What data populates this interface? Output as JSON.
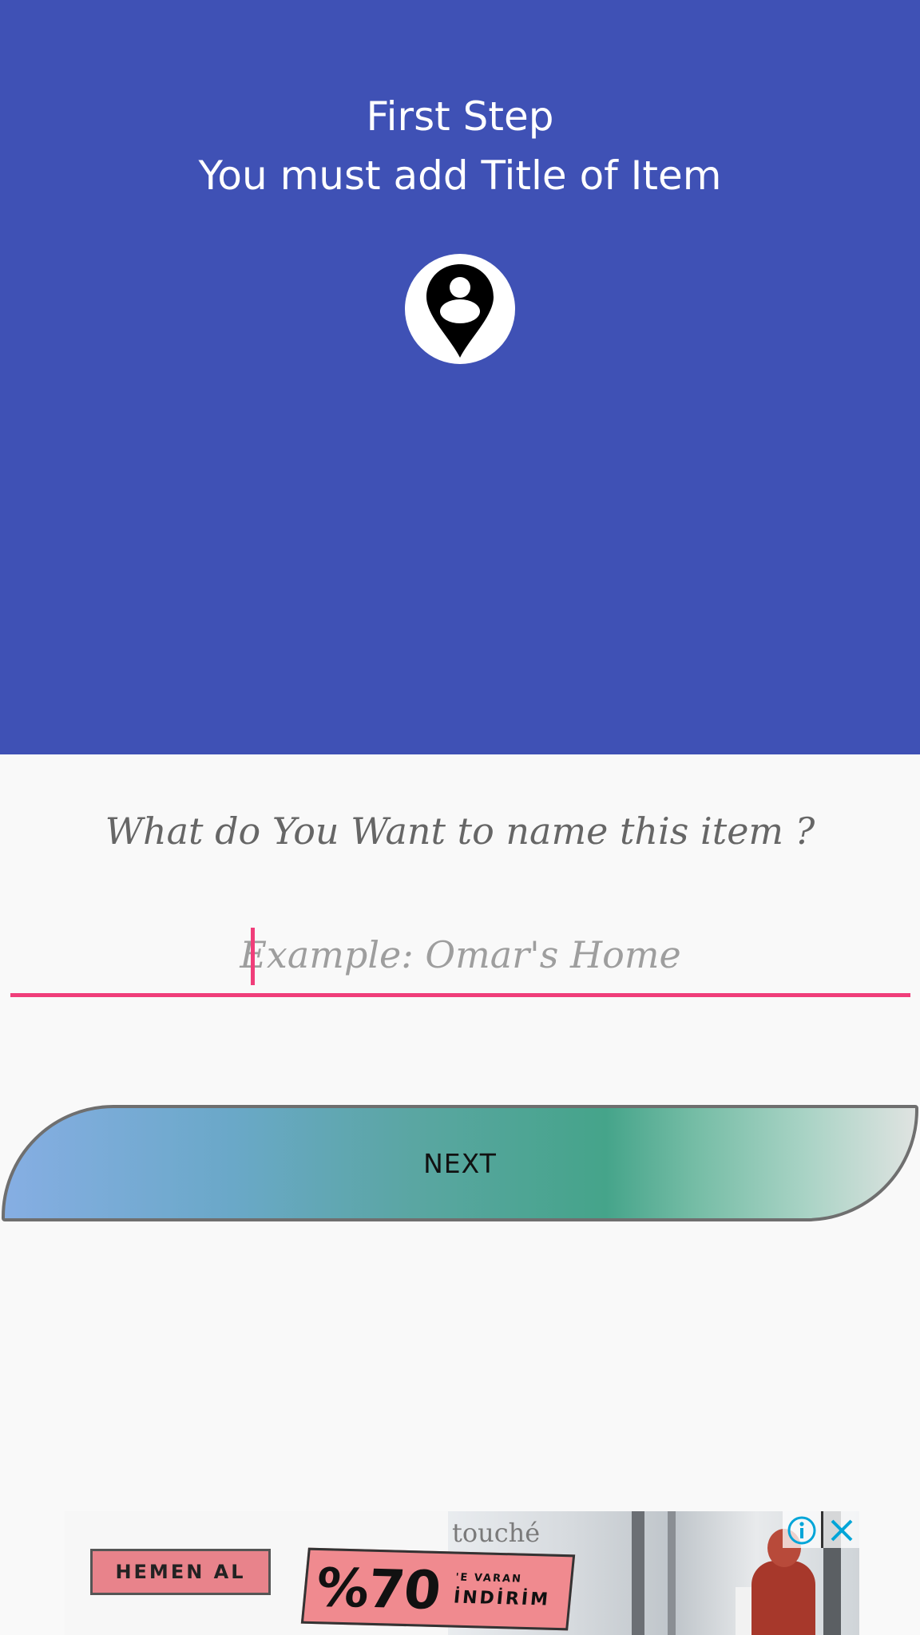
{
  "header": {
    "title": "First Step",
    "subtitle": "You must add Title of Item",
    "icon": "location-pin-person-icon",
    "background_color": "#3f51b5"
  },
  "form": {
    "question": "What do You Want to name this item ?",
    "name_input": {
      "value": "",
      "placeholder": "Example: Omar's Home"
    },
    "accent_color": "#f03e7a"
  },
  "actions": {
    "next_label": "NEXT"
  },
  "ad": {
    "brand": "touché",
    "cta": "HEMEN AL",
    "promo_big": "%70",
    "promo_small_top": "'E VARAN",
    "promo_small_bottom": "İNDİRİM",
    "info_icon": "info-icon",
    "close_icon": "close-icon"
  }
}
